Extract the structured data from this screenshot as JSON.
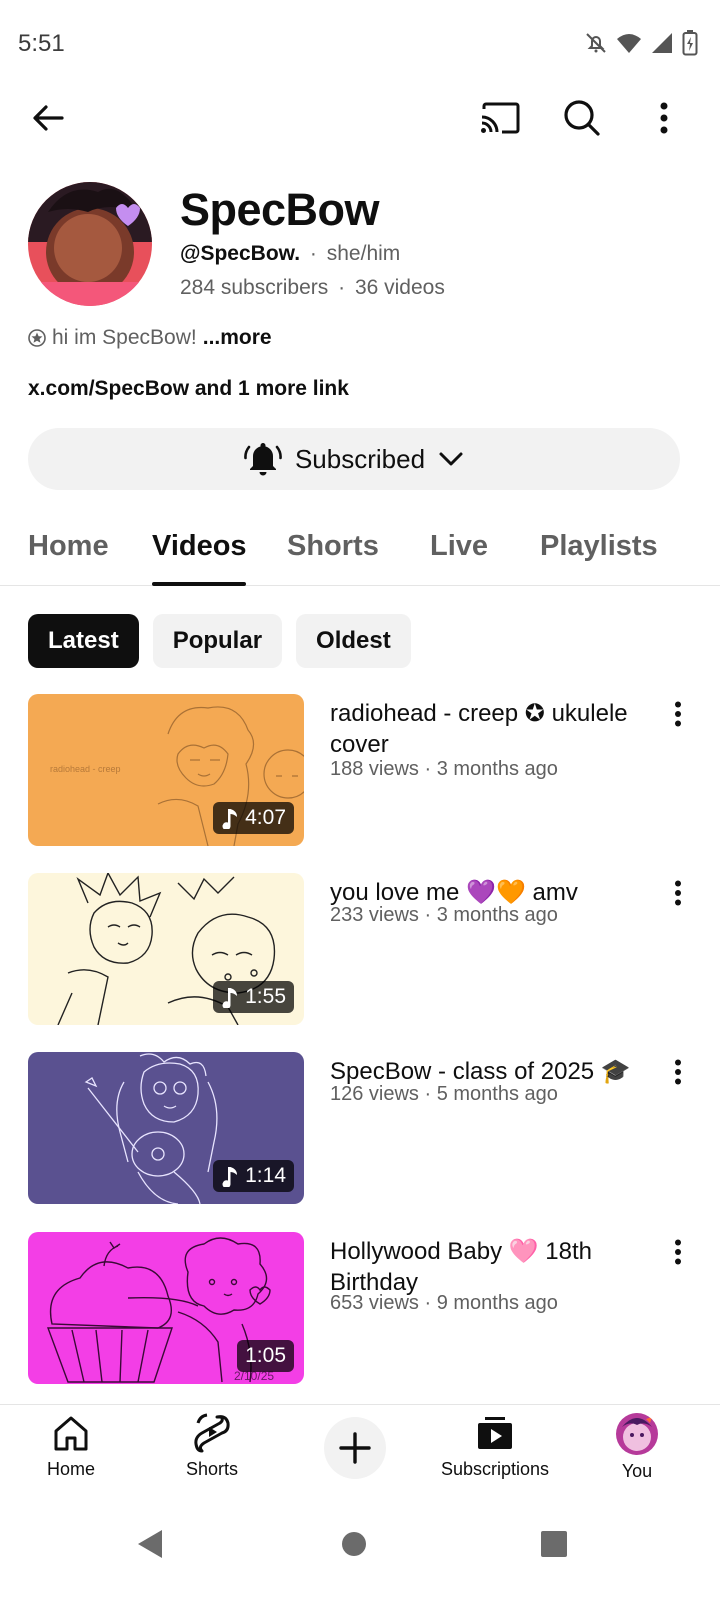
{
  "status_bar": {
    "time": "5:51"
  },
  "channel": {
    "name": "SpecBow",
    "handle": "@SpecBow.",
    "pronouns": "she/him",
    "subscribers": "284 subscribers",
    "videos_count": "36 videos",
    "bio": "hi im SpecBow!",
    "more_label": "...more",
    "links": "x.com/SpecBow and 1 more link",
    "separator": "·"
  },
  "subscribe": {
    "label": "Subscribed"
  },
  "tabs": [
    {
      "label": "Home"
    },
    {
      "label": "Videos"
    },
    {
      "label": "Shorts"
    },
    {
      "label": "Live"
    },
    {
      "label": "Playlists"
    }
  ],
  "active_tab": "Videos",
  "chips": [
    {
      "label": "Latest"
    },
    {
      "label": "Popular"
    },
    {
      "label": "Oldest"
    }
  ],
  "active_chip": "Latest",
  "videos": [
    {
      "title": "radiohead - creep ✪ ukulele cover",
      "meta": "188 views · 3 months ago",
      "duration": "4:07",
      "thumb_text": "radiohead - creep",
      "thumb_color": "#f4a953",
      "music": true
    },
    {
      "title": "you love me 💜🧡 amv",
      "meta": "233 views · 3 months ago",
      "duration": "1:55",
      "thumb_color": "#fdf6dc",
      "music": true
    },
    {
      "title": "SpecBow - class of 2025 🎓",
      "meta": "126 views · 5 months ago",
      "duration": "1:14",
      "thumb_color": "#5a5190",
      "music": true
    },
    {
      "title": "Hollywood Baby 🩷 18th Birthday",
      "meta": "653 views · 9 months ago",
      "duration": "1:05",
      "thumb_text": "2/10/25",
      "thumb_color": "#f33ee6",
      "music": false
    }
  ],
  "bottom_nav": [
    {
      "label": "Home"
    },
    {
      "label": "Shorts"
    },
    {
      "label": "Subscriptions"
    },
    {
      "label": "You"
    }
  ]
}
